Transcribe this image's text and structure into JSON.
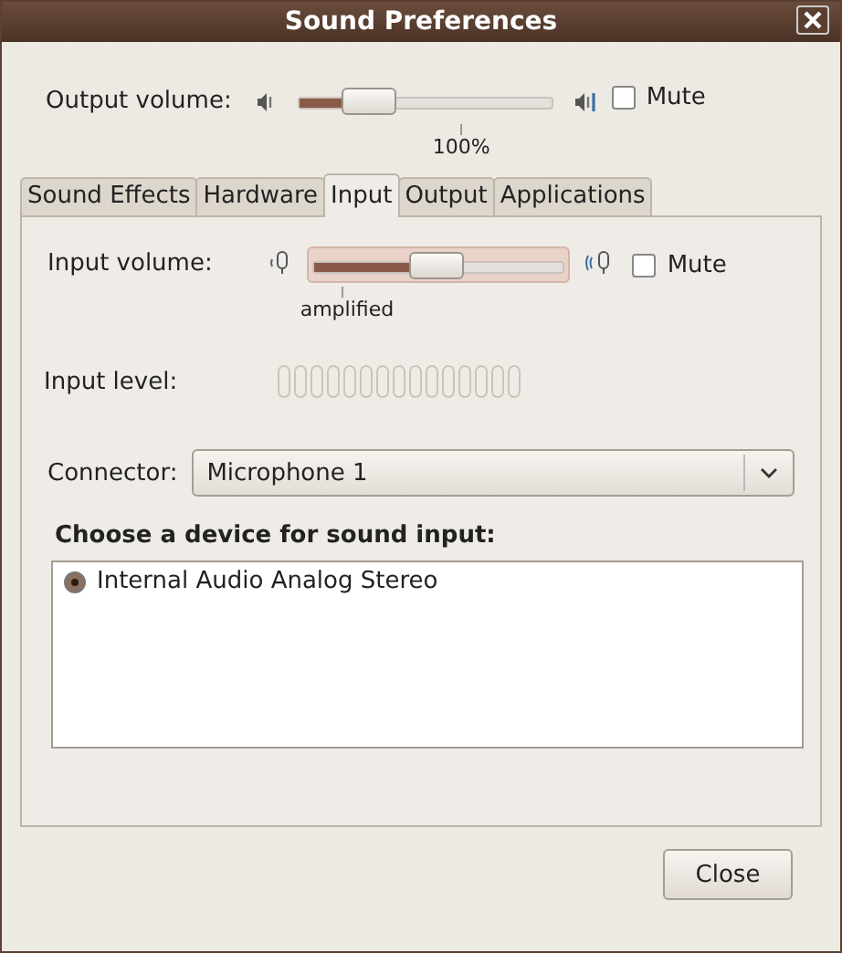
{
  "window": {
    "title": "Sound Preferences"
  },
  "output_volume": {
    "label": "Output volume:",
    "level": 0.28,
    "mark": "100%",
    "mute": {
      "label": "Mute",
      "checked": false
    }
  },
  "tabs": [
    {
      "label": "Sound Effects",
      "selected": false
    },
    {
      "label": "Hardware",
      "selected": false
    },
    {
      "label": "Input",
      "selected": true
    },
    {
      "label": "Output",
      "selected": false
    },
    {
      "label": "Applications",
      "selected": false
    }
  ],
  "input_volume": {
    "label": "Input volume:",
    "level": 0.48,
    "mark": "amplified",
    "mute": {
      "label": "Mute",
      "checked": false
    }
  },
  "input_level": {
    "label": "Input level:"
  },
  "connector": {
    "label": "Connector:",
    "value": "Microphone 1"
  },
  "device_list": {
    "heading": "Choose a device for sound input:",
    "items": [
      {
        "label": "Internal Audio Analog Stereo",
        "selected": true
      }
    ]
  },
  "buttons": [
    {
      "label": "Close"
    }
  ]
}
